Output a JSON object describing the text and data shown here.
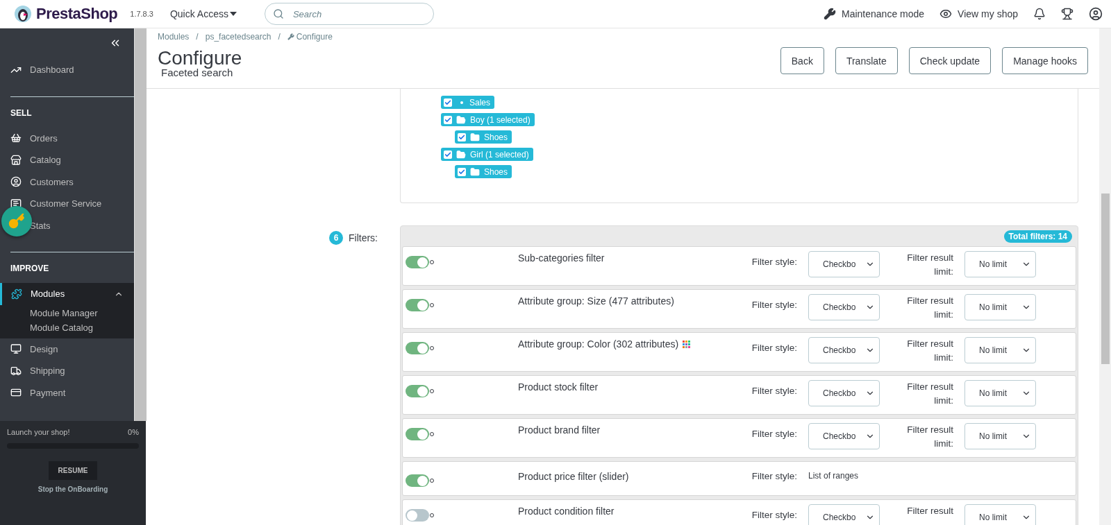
{
  "header": {
    "logo": "PrestaShop",
    "version": "1.7.8.3",
    "quick_access": "Quick Access",
    "search": {
      "placeholder": "Search"
    },
    "links": [
      "Maintenance mode",
      "View my shop"
    ]
  },
  "sidebar": {
    "groups": [
      {
        "items": [
          {
            "label": "Dashboard",
            "selected": false
          }
        ]
      },
      {
        "title": "SELL",
        "items": [
          {
            "label": "Orders",
            "selected": false
          },
          {
            "label": "Catalog",
            "selected": false
          },
          {
            "label": "Customers",
            "selected": false
          },
          {
            "label": "Customer Service",
            "selected": false
          },
          {
            "label": "Stats",
            "selected": false
          }
        ]
      },
      {
        "title": "IMPROVE",
        "items": [
          {
            "label": "Modules",
            "selected": true,
            "expanded": true,
            "children": [
              "Module Manager",
              "Module Catalog"
            ]
          },
          {
            "label": "Design",
            "selected": false
          },
          {
            "label": "Shipping",
            "selected": false
          },
          {
            "label": "Payment",
            "selected": false
          }
        ]
      }
    ]
  },
  "onboarding": {
    "title": "Launch your shop!",
    "percent": "0%",
    "level": 0,
    "button": "RESUME",
    "link": "Stop the OnBoarding"
  },
  "toolbar": {
    "breadcrumb": [
      "Modules",
      "ps_facetedsearch",
      "Configure"
    ],
    "breadcrumb_separators": [
      "/",
      "/"
    ],
    "title": "Configure",
    "subtitle": "Faceted search",
    "buttons": [
      "Back",
      "Translate",
      "Check update",
      "Manage hooks"
    ]
  },
  "tree": [
    {
      "label": "Sales",
      "kind": "leaf",
      "checked": true
    },
    {
      "label": "Boy (1 selected)",
      "kind": "folder",
      "expanded": true,
      "checked": true,
      "children": [
        {
          "label": "Shoes",
          "kind": "folder",
          "expanded": false,
          "checked": true
        }
      ]
    },
    {
      "label": "Girl (1 selected)",
      "kind": "folder",
      "expanded": true,
      "checked": true,
      "children": [
        {
          "label": "Shoes",
          "kind": "folder",
          "expanded": false,
          "checked": true
        }
      ]
    }
  ],
  "filters": {
    "step": "6",
    "label": "Filters:",
    "total": "Total filters: 14",
    "rows": [
      {
        "name": "Sub-categories filter",
        "on": true,
        "color_swatch": false,
        "kind": "select",
        "style_label": "Filter style:",
        "style": "Checkbo",
        "limit_label": "Filter result limit:",
        "limit": "No limit"
      },
      {
        "name": "Attribute group: Size (477 attributes)",
        "on": true,
        "color_swatch": false,
        "kind": "select",
        "style_label": "Filter style:",
        "style": "Checkbo",
        "limit_label": "Filter result limit:",
        "limit": "No limit"
      },
      {
        "name": "Attribute group: Color (302 attributes)",
        "on": true,
        "color_swatch": true,
        "kind": "select",
        "style_label": "Filter style:",
        "style": "Checkbo",
        "limit_label": "Filter result limit:",
        "limit": "No limit"
      },
      {
        "name": "Product stock filter",
        "on": true,
        "color_swatch": false,
        "kind": "select",
        "style_label": "Filter style:",
        "style": "Checkbo",
        "limit_label": "Filter result limit:",
        "limit": "No limit"
      },
      {
        "name": "Product brand filter",
        "on": true,
        "color_swatch": false,
        "kind": "select",
        "style_label": "Filter style:",
        "style": "Checkbo",
        "limit_label": "Filter result limit:",
        "limit": "No limit"
      },
      {
        "name": "Product price filter (slider)",
        "on": true,
        "color_swatch": false,
        "kind": "text",
        "style_label": "Filter style:",
        "style": "List of ranges"
      },
      {
        "name": "Product condition filter",
        "on": false,
        "color_swatch": false,
        "kind": "select",
        "style_label": "Filter style:",
        "style": "Checkbo",
        "limit_label": "Filter result",
        "limit": "No limit"
      }
    ]
  }
}
